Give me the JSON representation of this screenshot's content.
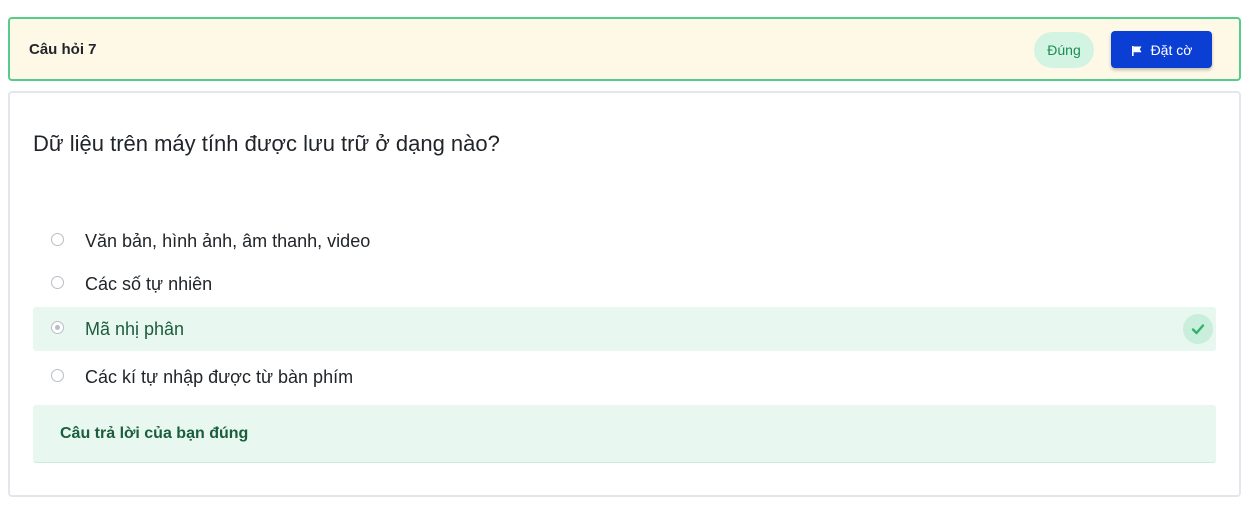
{
  "header": {
    "title": "Câu hỏi 7",
    "status": "Đúng",
    "flag_label": "Đặt cờ",
    "accent_color": "#0b3fd4",
    "border_color": "#55cc8a"
  },
  "question": {
    "text": "Dữ liệu trên máy tính được lưu trữ ở dạng nào?",
    "options": [
      {
        "label": "Văn bản, hình ảnh, âm thanh, video",
        "selected": false,
        "correct": false
      },
      {
        "label": "Các số tự nhiên",
        "selected": false,
        "correct": false
      },
      {
        "label": "Mã nhị phân",
        "selected": true,
        "correct": true
      },
      {
        "label": "Các kí tự nhập được từ bàn phím",
        "selected": false,
        "correct": false
      }
    ]
  },
  "feedback": {
    "text": "Câu trả lời của bạn đúng"
  },
  "icons": {
    "flag": "flag-icon",
    "check": "check-icon"
  }
}
